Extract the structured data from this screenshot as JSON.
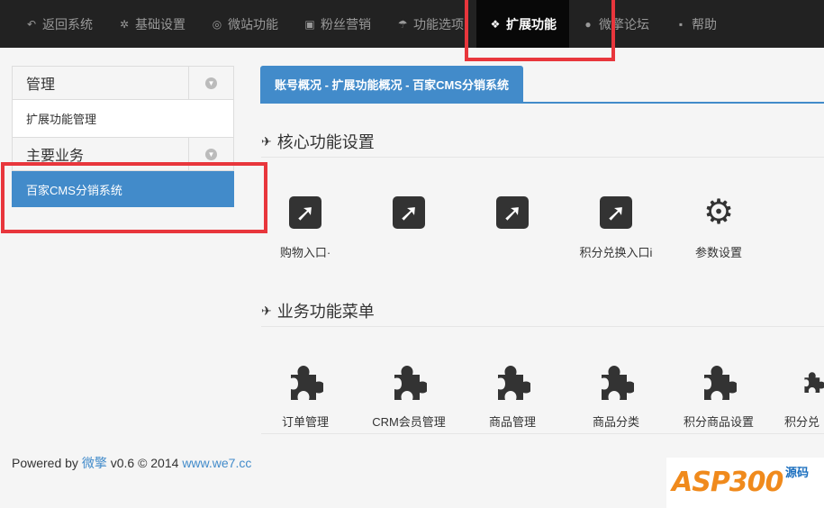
{
  "nav": {
    "items": [
      {
        "label": "返回系统",
        "icon": "reply-icon",
        "glyph": "↶"
      },
      {
        "label": "基础设置",
        "icon": "gear-icon",
        "glyph": "✲"
      },
      {
        "label": "微站功能",
        "icon": "lifebuoy-icon",
        "glyph": "◎"
      },
      {
        "label": "粉丝营销",
        "icon": "gift-icon",
        "glyph": "▣"
      },
      {
        "label": "功能选项",
        "icon": "umbrella-icon",
        "glyph": "☂"
      },
      {
        "label": "扩展功能",
        "icon": "cubes-icon",
        "glyph": "❖"
      },
      {
        "label": "微擎论坛",
        "icon": "comment-icon",
        "glyph": "●"
      },
      {
        "label": "帮助",
        "icon": "briefcase-icon",
        "glyph": "▪"
      }
    ],
    "active_index": 5
  },
  "sidebar": {
    "group1_title": "管理",
    "group1_item": "扩展功能管理",
    "group2_title": "主要业务",
    "group2_item": "百家CMS分销系统"
  },
  "breadcrumb": "账号概况 - 扩展功能概况 - 百家CMS分销系统",
  "core": {
    "title": "核心功能设置",
    "tiles": [
      {
        "label": "购物入口·",
        "icon": "external-link-icon"
      },
      {
        "label": "",
        "icon": "external-link-icon"
      },
      {
        "label": "",
        "icon": "external-link-icon"
      },
      {
        "label": "积分兑换入口i",
        "icon": "external-link-icon"
      },
      {
        "label": "参数设置",
        "icon": "gear-icon"
      }
    ]
  },
  "business": {
    "title": "业务功能菜单",
    "tiles": [
      {
        "label": "订单管理",
        "icon": "puzzle-icon"
      },
      {
        "label": "CRM会员管理",
        "icon": "puzzle-icon"
      },
      {
        "label": "商品管理",
        "icon": "puzzle-icon"
      },
      {
        "label": "商品分类",
        "icon": "puzzle-icon"
      },
      {
        "label": "积分商品设置",
        "icon": "puzzle-icon"
      },
      {
        "label": "积分兑",
        "icon": "puzzle-icon"
      }
    ]
  },
  "footer": {
    "prefix": "Powered by",
    "brand": "微擎",
    "version": "v0.6 © 2014",
    "link": "www.we7.cc"
  },
  "watermark": {
    "text": "ASP300",
    "sub": "源码"
  },
  "colors": {
    "accent": "#428bca",
    "highlight": "#e8363c",
    "nav_bg": "#222222"
  }
}
